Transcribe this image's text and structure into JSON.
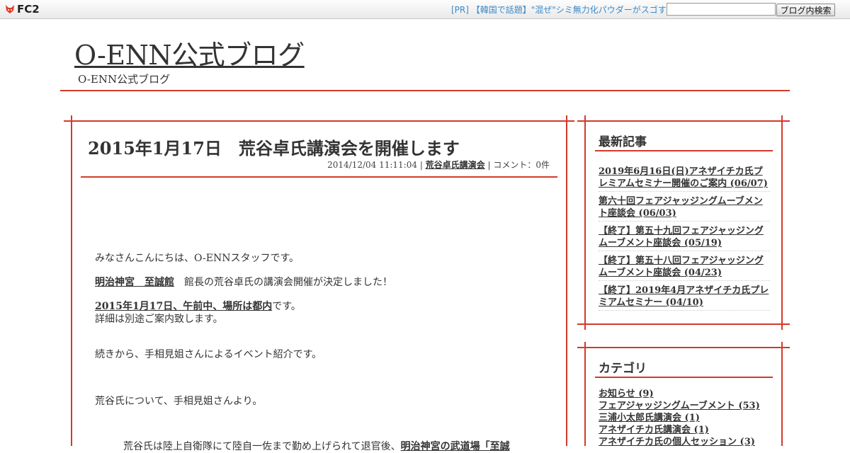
{
  "topbar": {
    "logo_text": "FC2",
    "pr_link": "[PR] 【韓国で話題】\"混ぜ\"シミ無力化パウダーがスゴす",
    "search_button": "ブログ内検索",
    "search_value": ""
  },
  "header": {
    "title": "O-ENN公式ブログ",
    "description": "O-ENN公式ブログ"
  },
  "entry": {
    "title": "2015年1月17日　荒谷卓氏講演会を開催します",
    "meta_date": "2014/12/04 11:11:04 | ",
    "meta_category": "荒谷卓氏講演会",
    "meta_comments": " | コメント：0件",
    "p1": "みなさんこんにちは、O-ENNスタッフです。",
    "p2_link": "明治神宮　至誠館",
    "p2_text": "　館長の荒谷卓氏の講演会開催が決定しました！",
    "p3_link": "2015年1月17日、午前中、場所は都内",
    "p3_text": "です。",
    "p3b": "詳細は別途ご案内致します。",
    "p4": "続きから、手相見姐さんによるイベント紹介です。",
    "p5": "荒谷氏について、手相見姐さんより。",
    "p6_text": "荒谷氏は陸上自衛隊にて陸自一佐まで勤め上げられて退官後、",
    "p6_link": "明治神宮の武道場「至誠"
  },
  "sidebar": {
    "recent_heading": "最新記事",
    "recent": [
      {
        "title": "2019年6月16日(日)アネザイチカ氏プレミアムセミナー開催のご案内",
        "date": "(06/07)"
      },
      {
        "title": "第六十回フェアジャッジングムーブメント座談会",
        "date": "(06/03)"
      },
      {
        "title": "【終了】第五十九回フェアジャッジングムーブメント座談会",
        "date": "(05/19)"
      },
      {
        "title": "【終了】第五十八回フェアジャッジングムーブメント座談会",
        "date": "(04/23)"
      },
      {
        "title": "【終了】2019年4月アネザイチカ氏プレミアムセミナー",
        "date": "(04/10)"
      }
    ],
    "category_heading": "カテゴリ",
    "categories": [
      {
        "name": "お知らせ",
        "count": "(9)"
      },
      {
        "name": "フェアジャッジングムーブメント",
        "count": "(53)"
      },
      {
        "name": "三浦小太郎氏講演会",
        "count": "(1)"
      },
      {
        "name": "アネザイチカ氏講演会",
        "count": "(1)"
      },
      {
        "name": "アネザイチカ氏の個人セッション",
        "count": "(3)"
      }
    ]
  },
  "colors": {
    "accent_red": "#d23a2a",
    "pr_link_blue": "#3b8ac9"
  }
}
